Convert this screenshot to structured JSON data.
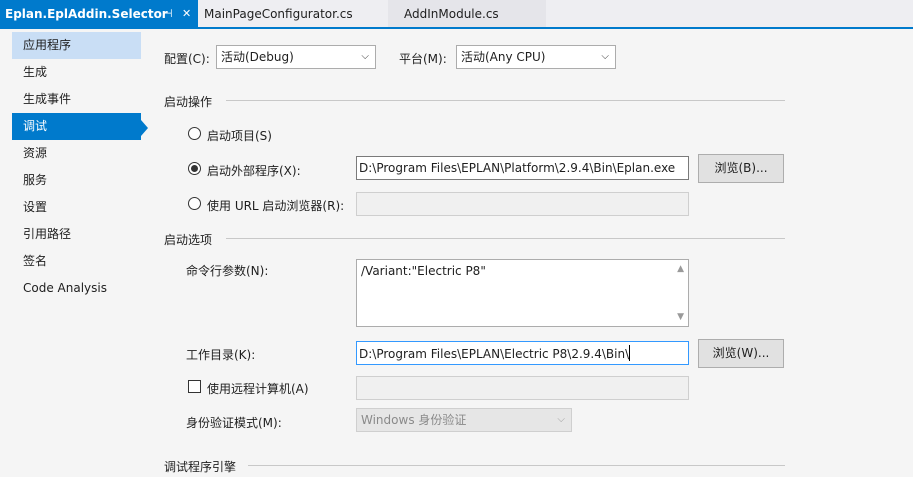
{
  "tabs": [
    {
      "label": "Eplan.EplAddin.Selector",
      "pin_icon": "pin-icon",
      "close_icon": "close-icon"
    },
    {
      "label": "MainPageConfigurator.cs"
    },
    {
      "label": "AddInModule.cs"
    }
  ],
  "sidebar": {
    "items": [
      {
        "label": "应用程序"
      },
      {
        "label": "生成"
      },
      {
        "label": "生成事件"
      },
      {
        "label": "调试"
      },
      {
        "label": "资源"
      },
      {
        "label": "服务"
      },
      {
        "label": "设置"
      },
      {
        "label": "引用路径"
      },
      {
        "label": "签名"
      },
      {
        "label": "Code Analysis"
      }
    ],
    "selected": "调试"
  },
  "config": {
    "configuration_label": "配置(C):",
    "configuration_value": "活动(Debug)",
    "platform_label": "平台(M):",
    "platform_value": "活动(Any CPU)"
  },
  "start_action": {
    "title": "启动操作",
    "start_project_label": "启动项目(S)",
    "start_external_label": "启动外部程序(X):",
    "start_external_value": "D:\\Program Files\\EPLAN\\Platform\\2.9.4\\Bin\\Eplan.exe",
    "browse_external_label": "浏览(B)...",
    "start_url_label": "使用 URL 启动浏览器(R):",
    "start_url_value": ""
  },
  "start_options": {
    "title": "启动选项",
    "cmd_args_label": "命令行参数(N):",
    "cmd_args_value": "/Variant:\"Electric P8\"",
    "working_dir_label": "工作目录(K):",
    "working_dir_value": "D:\\Program Files\\EPLAN\\Electric P8\\2.9.4\\Bin\\",
    "browse_workdir_label": "浏览(W)...",
    "remote_machine_label": "使用远程计算机(A)",
    "remote_machine_value": "",
    "auth_mode_label": "身份验证模式(M):",
    "auth_mode_value": "Windows 身份验证"
  },
  "debugger_engines": {
    "title": "调试程序引擎"
  },
  "colors": {
    "accent": "#007acc",
    "hover": "#c9def5"
  }
}
